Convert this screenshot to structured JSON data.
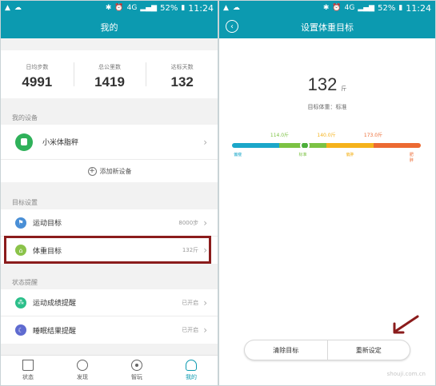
{
  "status_bar": {
    "battery": "52%",
    "time": "11:24",
    "network": "4G"
  },
  "left": {
    "title": "我的",
    "stats": [
      {
        "label": "日均步数",
        "value": "4991"
      },
      {
        "label": "总公里数",
        "value": "1419"
      },
      {
        "label": "达标天数",
        "value": "132"
      }
    ],
    "devices_section": "我的设备",
    "device_name": "小米体脂秤",
    "add_device": "添加新设备",
    "goals_section": "目标设置",
    "goal_rows": [
      {
        "label": "运动目标",
        "value": "8000步"
      },
      {
        "label": "体重目标",
        "value": "132斤"
      }
    ],
    "reminders_section": "状态提醒",
    "reminder_rows": [
      {
        "label": "运动成绩提醒",
        "value": "已开启"
      },
      {
        "label": "睡眠结果提醒",
        "value": "已开启"
      }
    ],
    "tabs": [
      "状态",
      "发现",
      "智玩",
      "我的"
    ]
  },
  "right": {
    "title": "设置体重目标",
    "weight_value": "132",
    "weight_unit": "斤",
    "weight_state": "目标体重：标准",
    "ticks": [
      "114.0斤",
      "140.0斤",
      "173.0斤"
    ],
    "categories": [
      "偏瘦",
      "标准",
      "偏胖",
      "肥胖"
    ],
    "clear_button": "清除目标",
    "reset_button": "重新设定",
    "watermark": "shouji.com.cn"
  },
  "colors": {
    "primary": "#0c9ab0",
    "highlight_border": "#8b1c1c",
    "seg_thin": "#1ba7c9",
    "seg_normal": "#7cc243",
    "seg_over": "#f5b21b",
    "seg_obese": "#ec6a32",
    "knob": "#4caf3a",
    "goal_icon_sport": "#4a8fd6",
    "goal_icon_weight": "#8bc34a",
    "reminder_icon_sport": "#2bbf8a",
    "reminder_icon_sleep": "#5f6bd0"
  }
}
